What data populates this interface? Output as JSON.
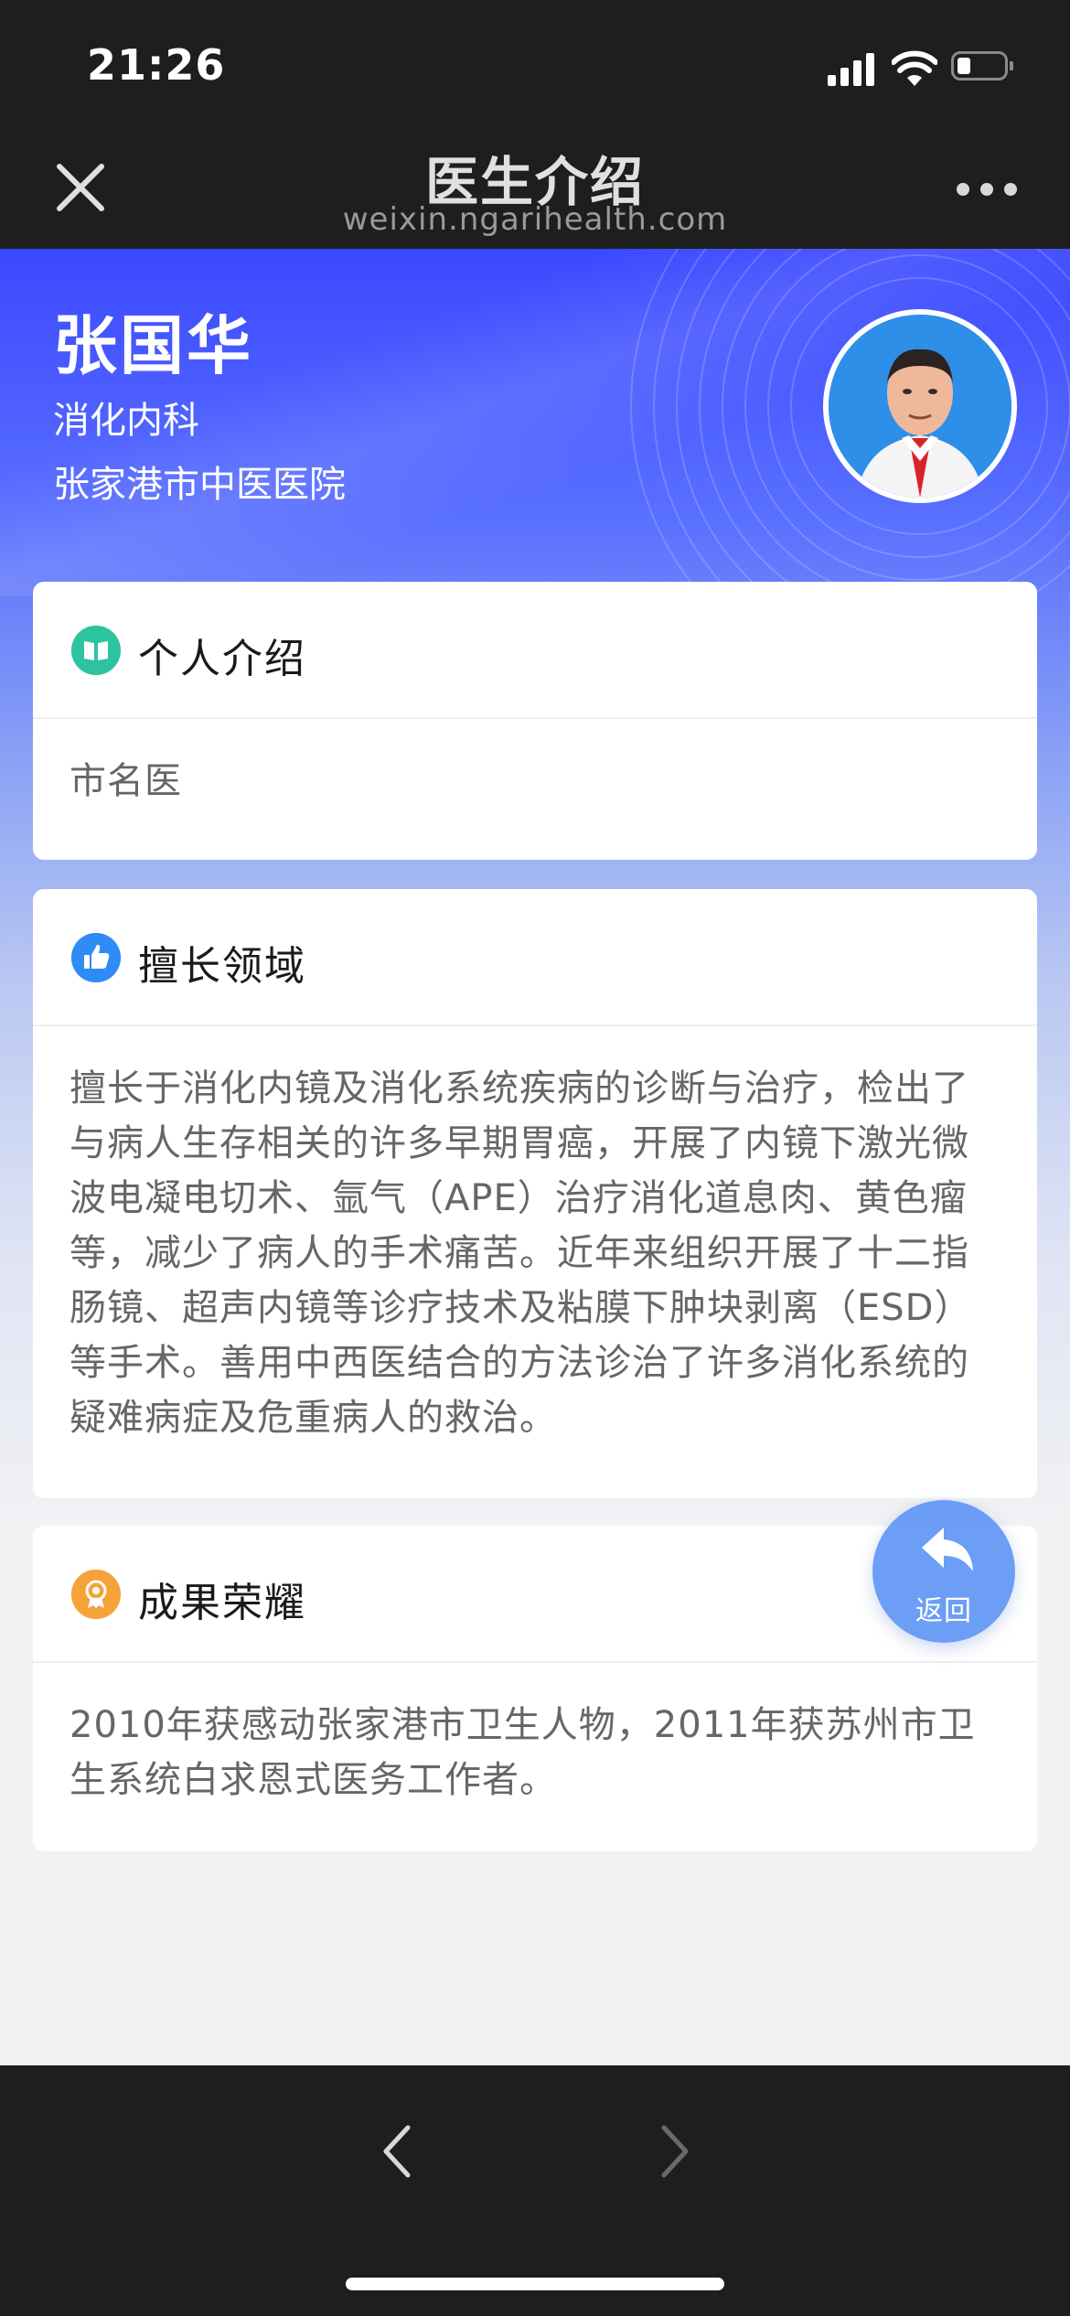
{
  "status_bar": {
    "time": "21:26"
  },
  "nav": {
    "title": "医生介绍",
    "domain": "weixin.ngarihealth.com",
    "close_icon": "close-icon",
    "more_icon": "more-icon"
  },
  "doctor": {
    "name": "张国华",
    "department": "消化内科",
    "hospital": "张家港市中医医院"
  },
  "sections": {
    "intro": {
      "title": "个人介绍",
      "icon": "book-icon",
      "text": "市名医"
    },
    "specialty": {
      "title": "擅长领域",
      "icon": "thumbs-up-icon",
      "text": "擅长于消化内镜及消化系统疾病的诊断与治疗，检出了与病人生存相关的许多早期胃癌，开展了内镜下激光微波电凝电切术、氩气（APE）治疗消化道息肉、黄色瘤等，减少了病人的手术痛苦。近年来组织开展了十二指肠镜、超声内镜等诊疗技术及粘膜下肿块剥离（ESD）等手术。善用中西医结合的方法诊治了许多消化系统的疑难病症及危重病人的救治。"
    },
    "honors": {
      "title": "成果荣耀",
      "icon": "award-icon",
      "text": "2010年获感动张家港市卫生人物，2011年获苏州市卫生系统白求恩式医务工作者。"
    }
  },
  "fab": {
    "label": "返回",
    "icon": "reply-arrow-icon"
  },
  "toolbar": {
    "back_icon": "chevron-left-icon",
    "forward_icon": "chevron-right-icon"
  },
  "colors": {
    "header_gradient_start": "#3b49ff",
    "fab_blue": "#5f96f5",
    "intro_icon": "#2ec3a0",
    "specialty_icon": "#2f8bf5",
    "honors_icon": "#f6a23a"
  }
}
